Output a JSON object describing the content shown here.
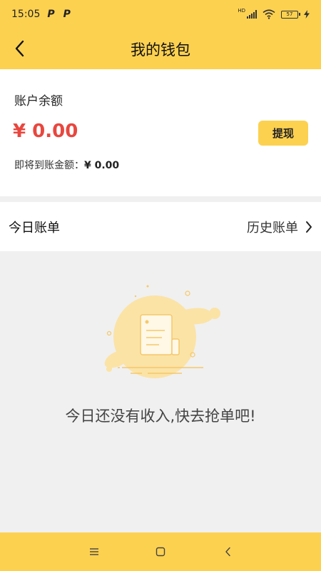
{
  "status_bar": {
    "time": "15:05",
    "notification_icons": [
      "P",
      "P"
    ],
    "network_label": "HD",
    "battery_label": "57"
  },
  "header": {
    "title": "我的钱包",
    "back_icon": "chevron-left-icon"
  },
  "balance": {
    "label": "账户余额",
    "amount": "¥ 0.00",
    "withdraw_label": "提现",
    "pending_label": "即将到账金额：",
    "pending_value": "¥ 0.00"
  },
  "bills": {
    "today_label": "今日账单",
    "history_label": "历史账单",
    "empty_text": "今日还没有收入,快去抢单吧!"
  },
  "nav_bar": {
    "menu_icon": "menu-icon",
    "home_icon": "square-home-icon",
    "back_icon": "back-arrow-icon"
  },
  "colors": {
    "brand_yellow": "#fdd150",
    "amount_red": "#e8473f",
    "background_gray": "#f0f0f0"
  }
}
